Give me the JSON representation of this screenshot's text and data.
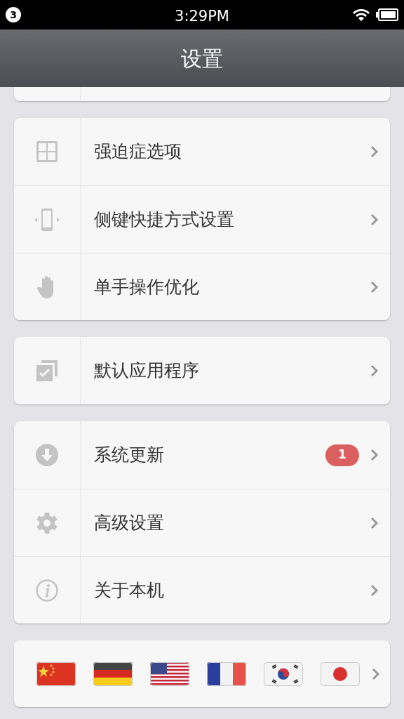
{
  "status_bar": {
    "notification_count": "3",
    "time": "3:29PM"
  },
  "title": "设置",
  "groups": [
    [
      {
        "kind": "grid",
        "label": "强迫症选项"
      },
      {
        "kind": "phone",
        "label": "侧键快捷方式设置"
      },
      {
        "kind": "hand",
        "label": "单手操作优化"
      }
    ],
    [
      {
        "kind": "check",
        "label": "默认应用程序"
      }
    ],
    [
      {
        "kind": "download",
        "label": "系统更新",
        "badge": "1"
      },
      {
        "kind": "gear",
        "label": "高级设置"
      },
      {
        "kind": "info",
        "label": "关于本机"
      }
    ]
  ],
  "flags": [
    {
      "kind": "cn"
    },
    {
      "kind": "de"
    },
    {
      "kind": "us"
    },
    {
      "kind": "fr"
    },
    {
      "kind": "kr"
    },
    {
      "kind": "jp"
    }
  ]
}
